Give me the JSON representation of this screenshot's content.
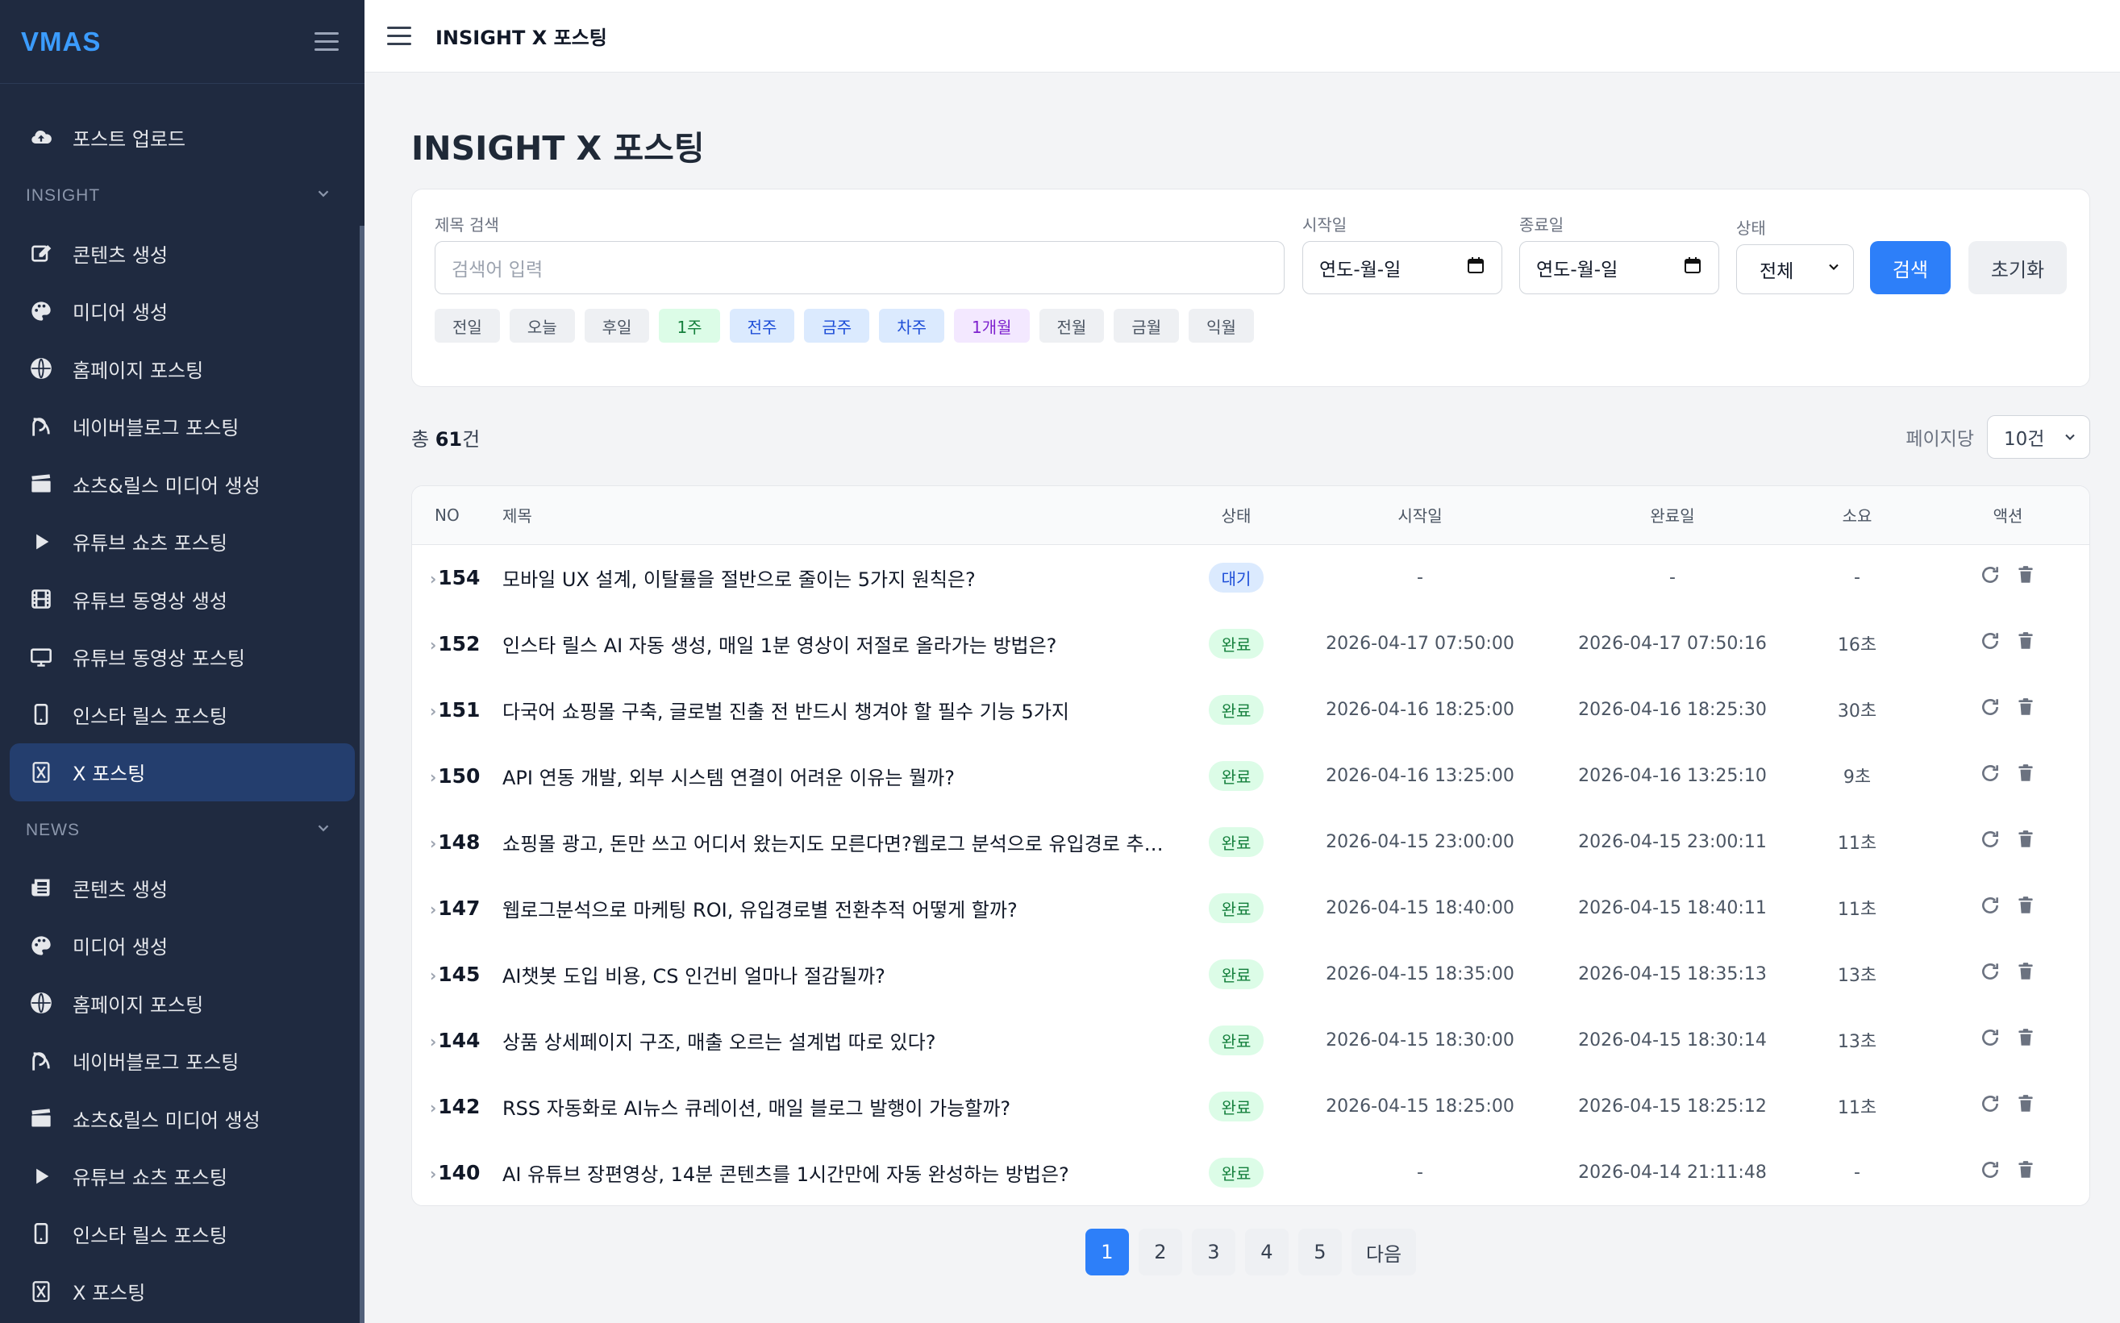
{
  "app": {
    "logo": "VMAS"
  },
  "topbar": {
    "title": "INSIGHT X 포스팅"
  },
  "sidebar": {
    "top_items": [
      {
        "label": "포스트 업로드",
        "icon": "cloud-upload-icon"
      }
    ],
    "insight_section": "INSIGHT",
    "insight_items": [
      {
        "label": "콘텐츠 생성",
        "icon": "edit-icon"
      },
      {
        "label": "미디어 생성",
        "icon": "palette-icon"
      },
      {
        "label": "홈페이지 포스팅",
        "icon": "globe-icon"
      },
      {
        "label": "네이버블로그 포스팅",
        "icon": "blog-icon"
      },
      {
        "label": "쇼츠&릴스 미디어 생성",
        "icon": "clapperboard-icon"
      },
      {
        "label": "유튜브 쇼츠 포스팅",
        "icon": "play-icon"
      },
      {
        "label": "유튜브 동영상 생성",
        "icon": "film-icon"
      },
      {
        "label": "유튜브 동영상 포스팅",
        "icon": "monitor-icon"
      },
      {
        "label": "인스타 릴스 포스팅",
        "icon": "mobile-icon"
      },
      {
        "label": "X 포스팅",
        "icon": "x-logo-icon"
      }
    ],
    "news_section": "NEWS",
    "news_items": [
      {
        "label": "콘텐츠 생성",
        "icon": "newspaper-icon"
      },
      {
        "label": "미디어 생성",
        "icon": "palette-icon"
      },
      {
        "label": "홈페이지 포스팅",
        "icon": "globe-icon"
      },
      {
        "label": "네이버블로그 포스팅",
        "icon": "blog-icon"
      },
      {
        "label": "쇼츠&릴스 미디어 생성",
        "icon": "clapperboard-icon"
      },
      {
        "label": "유튜브 쇼츠 포스팅",
        "icon": "play-icon"
      },
      {
        "label": "인스타 릴스 포스팅",
        "icon": "mobile-icon"
      },
      {
        "label": "X 포스팅",
        "icon": "x-logo-icon"
      }
    ]
  },
  "page": {
    "title": "INSIGHT X 포스팅"
  },
  "filter": {
    "title_label": "제목 검색",
    "title_placeholder": "검색어 입력",
    "start_label": "시작일",
    "start_value": "연도-월-일",
    "end_label": "종료일",
    "end_value": "연도-월-일",
    "status_label": "상태",
    "status_value": "전체",
    "search_button": "검색",
    "reset_button": "초기화",
    "chips": [
      "전일",
      "오늘",
      "후일",
      "1주",
      "전주",
      "금주",
      "차주",
      "1개월",
      "전월",
      "금월",
      "익월"
    ]
  },
  "summary": {
    "prefix": "총 ",
    "count": "61",
    "suffix": "건",
    "per_page_label": "페이지당",
    "per_page_value": "10건"
  },
  "table": {
    "headers": {
      "no": "NO",
      "title": "제목",
      "status": "상태",
      "start": "시작일",
      "end": "완료일",
      "duration": "소요",
      "action": "액션"
    },
    "rows": [
      {
        "no": "154",
        "title": "모바일 UX 설계, 이탈률을 절반으로 줄이는 5가지 원칙은?",
        "status": "대기",
        "start": "-",
        "end": "-",
        "duration": "-"
      },
      {
        "no": "152",
        "title": "인스타 릴스 AI 자동 생성, 매일 1분 영상이 저절로 올라가는 방법은?",
        "status": "완료",
        "start": "2026-04-17 07:50:00",
        "end": "2026-04-17 07:50:16",
        "duration": "16초"
      },
      {
        "no": "151",
        "title": "다국어 쇼핑몰 구축, 글로벌 진출 전 반드시 챙겨야 할 필수 기능 5가지",
        "status": "완료",
        "start": "2026-04-16 18:25:00",
        "end": "2026-04-16 18:25:30",
        "duration": "30초"
      },
      {
        "no": "150",
        "title": "API 연동 개발, 외부 시스템 연결이 어려운 이유는 뭘까?",
        "status": "완료",
        "start": "2026-04-16 13:25:00",
        "end": "2026-04-16 13:25:10",
        "duration": "9초"
      },
      {
        "no": "148",
        "title": "쇼핑몰 광고, 돈만 쓰고 어디서 왔는지도 모른다면?웹로그 분석으로 유입경로 추적하기",
        "status": "완료",
        "start": "2026-04-15 23:00:00",
        "end": "2026-04-15 23:00:11",
        "duration": "11초"
      },
      {
        "no": "147",
        "title": "웹로그분석으로 마케팅 ROI, 유입경로별 전환추적 어떻게 할까?",
        "status": "완료",
        "start": "2026-04-15 18:40:00",
        "end": "2026-04-15 18:40:11",
        "duration": "11초"
      },
      {
        "no": "145",
        "title": "AI챗봇 도입 비용, CS 인건비 얼마나 절감될까?",
        "status": "완료",
        "start": "2026-04-15 18:35:00",
        "end": "2026-04-15 18:35:13",
        "duration": "13초"
      },
      {
        "no": "144",
        "title": "상품 상세페이지 구조, 매출 오르는 설계법 따로 있다?",
        "status": "완료",
        "start": "2026-04-15 18:30:00",
        "end": "2026-04-15 18:30:14",
        "duration": "13초"
      },
      {
        "no": "142",
        "title": "RSS 자동화로 AI뉴스 큐레이션, 매일 블로그 발행이 가능할까?",
        "status": "완료",
        "start": "2026-04-15 18:25:00",
        "end": "2026-04-15 18:25:12",
        "duration": "11초"
      },
      {
        "no": "140",
        "title": "AI 유튜브 장편영상, 14분 콘텐츠를 1시간만에 자동 완성하는 방법은?",
        "status": "완료",
        "start": "-",
        "end": "2026-04-14 21:11:48",
        "duration": "-"
      }
    ]
  },
  "pager": {
    "pages": [
      "1",
      "2",
      "3",
      "4",
      "5"
    ],
    "next": "다음",
    "current": "1"
  },
  "colors": {
    "accent": "#2d7ff9",
    "sidebar_bg": "#1f2a40",
    "logo": "#3b9cff",
    "done": "#15803d",
    "wait": "#1d4ed8"
  }
}
